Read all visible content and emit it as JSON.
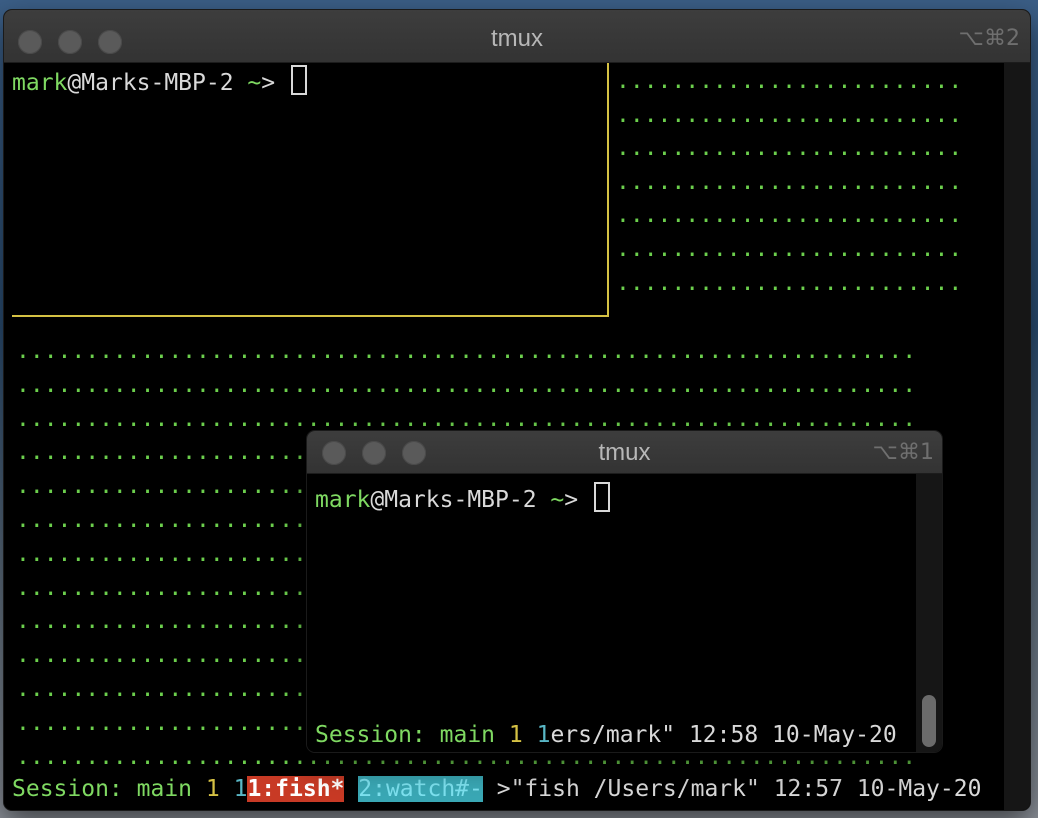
{
  "colors": {
    "green": "#7fd962",
    "yellow": "#d5c144",
    "cyan": "#59b7c6",
    "active_window_bg": "#c83a25",
    "inactive_window_bg": "#3aa8b5"
  },
  "back_window": {
    "title": "tmux",
    "shortcut": "⌥⌘2",
    "prompt": {
      "user": "mark",
      "host": "@Marks-MBP-2",
      "path": " ~",
      "symbol": "> "
    },
    "status_bar": {
      "session_label": "Session: main",
      "session_num": "1",
      "prefix": "1",
      "active_window": "1:fish*",
      "inactive_window": "2:watch#-",
      "pane_title": ">\"fish /Users/mark\"",
      "time": "12:57",
      "date": "10-May-20"
    }
  },
  "front_window": {
    "title": "tmux",
    "shortcut": "⌥⌘1",
    "prompt": {
      "user": "mark",
      "host": "@Marks-MBP-2",
      "path": " ~",
      "symbol": "> "
    },
    "status_bar": {
      "session_label": "Session: main",
      "session_num": "1",
      "prefix": "1",
      "pane_title": "ers/mark\"",
      "time": "12:58",
      "date": "10-May-20"
    }
  }
}
